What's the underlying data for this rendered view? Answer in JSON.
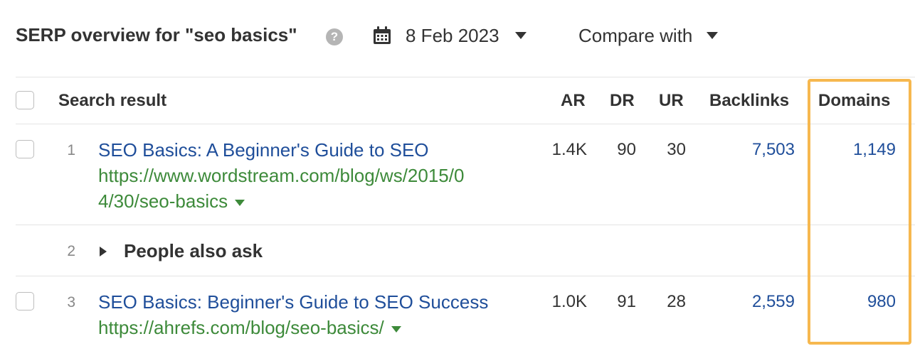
{
  "header": {
    "title": "SERP overview for \"seo basics\"",
    "help_icon": "question-circle-icon",
    "date_icon": "calendar-icon",
    "date_label": "8 Feb 2023",
    "compare_label": "Compare with"
  },
  "table": {
    "columns": [
      "Search result",
      "AR",
      "DR",
      "UR",
      "Backlinks",
      "Domains"
    ],
    "highlight_color": "#f6b84f",
    "rows": [
      {
        "position": "1",
        "title": "SEO Basics: A Beginner's Guide to SEO",
        "url_line1": "https://www.wordstream.com/blog/ws/2015/0",
        "url_line2": "4/30/seo-basics",
        "ar": "1.4K",
        "dr": "90",
        "ur": "30",
        "backlinks": "7,503",
        "domains": "1,149"
      },
      {
        "position": "2",
        "label": "People also ask"
      },
      {
        "position": "3",
        "title": "SEO Basics: Beginner's Guide to SEO Success",
        "url": "https://ahrefs.com/blog/seo-basics/",
        "ar": "1.0K",
        "dr": "91",
        "ur": "28",
        "backlinks": "2,559",
        "domains": "980"
      }
    ]
  }
}
